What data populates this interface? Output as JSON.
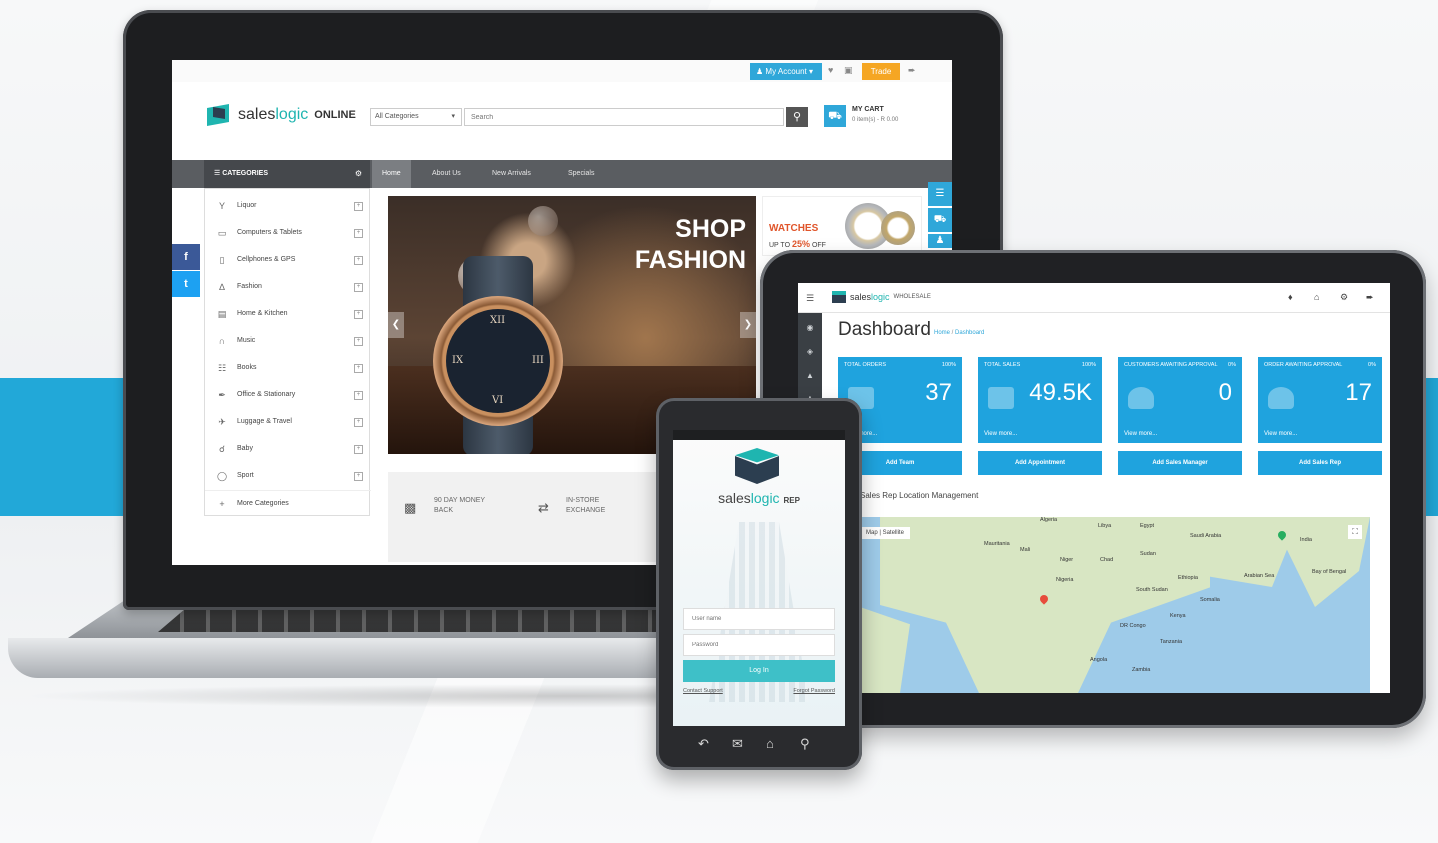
{
  "laptop": {
    "topbar": {
      "account_label": "My Account",
      "trade_label": "Trade"
    },
    "brand": {
      "name_plain": "sales",
      "name_accent": "logic",
      "suffix": "ONLINE"
    },
    "search": {
      "category_value": "All Categories",
      "placeholder": "Search"
    },
    "cart": {
      "title": "MY CART",
      "subtitle": "0 item(s) - R 0.00"
    },
    "categories_header": "CATEGORIES",
    "nav": [
      "Home",
      "About Us",
      "New Arrivals",
      "Specials"
    ],
    "social": [
      "f",
      "t"
    ],
    "categories": [
      {
        "label": "Liquor",
        "icon": "cocktail-icon"
      },
      {
        "label": "Computers & Tablets",
        "icon": "laptop-icon"
      },
      {
        "label": "Cellphones & GPS",
        "icon": "phone-icon"
      },
      {
        "label": "Fashion",
        "icon": "dress-icon"
      },
      {
        "label": "Home & Kitchen",
        "icon": "sofa-icon"
      },
      {
        "label": "Music",
        "icon": "headphones-icon"
      },
      {
        "label": "Books",
        "icon": "book-icon"
      },
      {
        "label": "Office & Stationary",
        "icon": "pen-icon"
      },
      {
        "label": "Luggage & Travel",
        "icon": "plane-icon"
      },
      {
        "label": "Baby",
        "icon": "pram-icon"
      },
      {
        "label": "Sport",
        "icon": "ball-icon"
      }
    ],
    "more_categories": "More Categories",
    "banner": {
      "line1": "SHOP",
      "line2": "FASHION"
    },
    "promo": {
      "title": "WATCHES",
      "subtitle": "UP TO",
      "discount": "25%",
      "suffix": "OFF"
    },
    "features": [
      {
        "label": "90 DAY MONEY BACK"
      },
      {
        "label": "IN-STORE EXCHANGE"
      }
    ]
  },
  "tablet": {
    "brand": {
      "name_plain": "sales",
      "name_accent": "logic",
      "suffix": "WHOLESALE"
    },
    "title": "Dashboard",
    "breadcrumb": {
      "home": "Home",
      "current": "Dashboard"
    },
    "stats": [
      {
        "label": "TOTAL ORDERS",
        "pct": "100%",
        "value": "37",
        "more": "View more..."
      },
      {
        "label": "TOTAL SALES",
        "pct": "100%",
        "value": "49.5K",
        "more": "View more..."
      },
      {
        "label": "CUSTOMERS AWAITING APPROVAL",
        "pct": "0%",
        "value": "0",
        "more": "View more..."
      },
      {
        "label": "ORDER AWAITING APPROVAL",
        "pct": "0%",
        "value": "17",
        "more": "View more..."
      }
    ],
    "actions": [
      "Add Team",
      "Add Appointment",
      "Add Sales Manager",
      "Add Sales Rep"
    ],
    "map_title": "Sales Rep Location Management",
    "map_buttons": [
      "Map",
      "Satellite"
    ],
    "map_labels": [
      "Algeria",
      "Libya",
      "Egypt",
      "Saudi Arabia",
      "Mauritania",
      "Mali",
      "Niger",
      "Chad",
      "Sudan",
      "Nigeria",
      "Ethiopia",
      "South Sudan",
      "Somalia",
      "Kenya",
      "DR Congo",
      "Tanzania",
      "Angola",
      "Zambia",
      "India",
      "Arabian Sea",
      "Bay of Bengal"
    ]
  },
  "phone": {
    "brand": {
      "name_plain": "sales",
      "name_accent": "logic",
      "suffix": "REP"
    },
    "username_placeholder": "User name",
    "password_placeholder": "Password",
    "login_label": "Log In",
    "contact_label": "Contact Support",
    "forgot_label": "Forgot Password"
  }
}
